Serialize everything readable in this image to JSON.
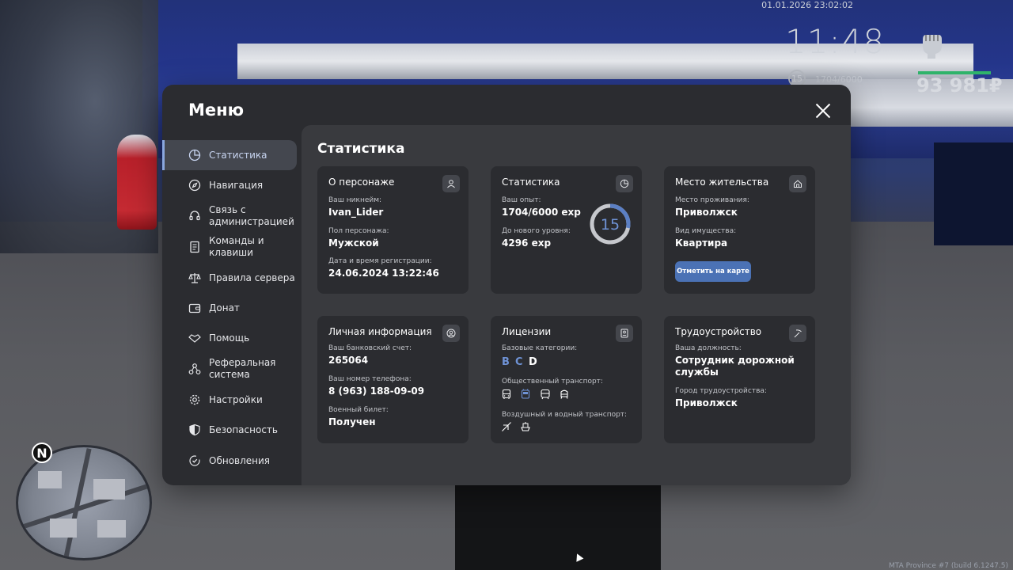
{
  "hud": {
    "datetime": "01.01.2026 23:02:02",
    "time": "11:48",
    "level": "15",
    "exp": "1704/6000",
    "money": "93 981₽",
    "build": "MTA Province #7 (build 6.1247.5)"
  },
  "menu": {
    "title": "Меню",
    "sidebar": [
      {
        "label": "Статистика",
        "icon": "pie-chart-icon",
        "active": true
      },
      {
        "label": "Навигация",
        "icon": "compass-icon"
      },
      {
        "label": "Связь с администрацией",
        "icon": "headset-icon"
      },
      {
        "label": "Команды и клавиши",
        "icon": "document-icon"
      },
      {
        "label": "Правила сервера",
        "icon": "scales-icon"
      },
      {
        "label": "Донат",
        "icon": "wallet-icon"
      },
      {
        "label": "Помощь",
        "icon": "handshake-icon"
      },
      {
        "label": "Реферальная система",
        "icon": "network-icon"
      },
      {
        "label": "Настройки",
        "icon": "gear-icon"
      },
      {
        "label": "Безопасность",
        "icon": "shield-icon"
      },
      {
        "label": "Обновления",
        "icon": "update-icon"
      }
    ]
  },
  "content": {
    "title": "Статистика",
    "about": {
      "title": "О персонаже",
      "nickname_label": "Ваш никнейм:",
      "nickname": "Ivan_Lider",
      "gender_label": "Пол персонажа:",
      "gender": "Мужской",
      "reg_label": "Дата и время регистрации:",
      "reg": "24.06.2024 13:22:46"
    },
    "stats": {
      "title": "Статистика",
      "exp_label": "Ваш опыт:",
      "exp": "1704/6000 exp",
      "next_label": "До нового уровня:",
      "next": "4296 exp",
      "level": "15",
      "progress": 0.284
    },
    "residence": {
      "title": "Место жительства",
      "place_label": "Место проживания:",
      "place": "Приволжск",
      "property_label": "Вид имущества:",
      "property": "Квартира",
      "map_button": "Отметить на карте"
    },
    "personal": {
      "title": "Личная информация",
      "bank_label": "Ваш банковский счет:",
      "bank": "265064",
      "phone_label": "Ваш номер телефона:",
      "phone": "8 (963) 188-09-09",
      "military_label": "Военный билет:",
      "military": "Получен"
    },
    "licenses": {
      "title": "Лицензии",
      "base_label": "Базовые категории:",
      "categories": [
        "B",
        "C",
        "D"
      ],
      "public_label": "Общественный транспорт:",
      "air_label": "Воздушный и водный транспорт:",
      "colors": {
        "owned": "#6f93d6",
        "not_owned": "#ffffff"
      }
    },
    "employment": {
      "title": "Трудоустройство",
      "position_label": "Ваша должность:",
      "position": "Сотрудник дорожной службы",
      "city_label": "Город трудоустройства:",
      "city": "Приволжск"
    }
  }
}
